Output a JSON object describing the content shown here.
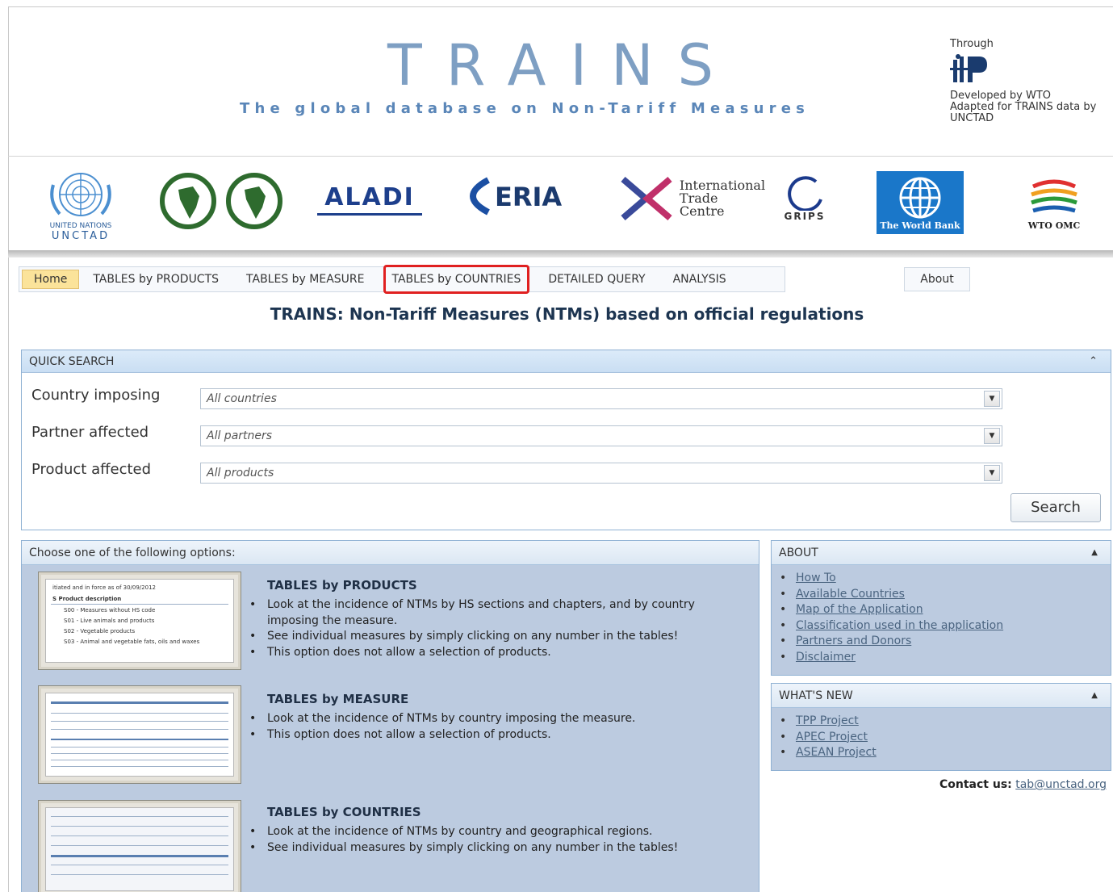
{
  "header": {
    "title": "TRAINS",
    "subtitle": "The global database on Non-Tariff Measures",
    "through_label": "Through",
    "developed_by": "Developed by WTO",
    "adapted_for": "Adapted for TRAINS data by UNCTAD"
  },
  "logos": {
    "unctad_line1": "UNITED NATIONS",
    "unctad_line2": "UNCTAD",
    "aladi": "ALADI",
    "eria": "ERIA",
    "itc_line1": "International",
    "itc_line2": "Trade",
    "itc_line3": "Centre",
    "grips": "GRIPS",
    "worldbank": "The World Bank",
    "wto": "WTO OMC"
  },
  "nav": {
    "home": "Home",
    "tables_products": "TABLES by PRODUCTS",
    "tables_measure": "TABLES by MEASURE",
    "tables_countries": "TABLES by COUNTRIES",
    "detailed_query": "DETAILED QUERY",
    "analysis": "ANALYSIS",
    "about": "About"
  },
  "page_heading": "TRAINS: Non-Tariff Measures (NTMs) based on official regulations",
  "quick_search": {
    "header": "QUICK SEARCH",
    "country_label": "Country imposing",
    "country_value": "All countries",
    "partner_label": "Partner affected",
    "partner_value": "All partners",
    "product_label": "Product affected",
    "product_value": "All products",
    "search_button": "Search"
  },
  "options": {
    "header": "Choose one of the following options:",
    "items": [
      {
        "title": "TABLES by PRODUCTS",
        "bullets": [
          "Look at the incidence of NTMs by HS sections and chapters, and by country imposing the measure.",
          "See individual measures by simply clicking on any number in the tables!",
          "This option does not allow a selection of products."
        ],
        "thumb_lines": [
          "itiated and in force  as of  30/09/2012",
          "S Product description",
          "S00 - Measures without HS code",
          "S01 - Live animals and products",
          "S02 - Vegetable products",
          "S03 - Animal and vegetable fats, oils and waxes"
        ]
      },
      {
        "title": "TABLES by MEASURE",
        "bullets": [
          "Look at the incidence of NTMs by country imposing the measure.",
          "This option does not allow a selection of products."
        ]
      },
      {
        "title": "TABLES by COUNTRIES",
        "bullets": [
          "Look at the incidence of NTMs by country and geographical regions.",
          "See individual measures by simply clicking on any number in the tables!"
        ]
      }
    ]
  },
  "about": {
    "header": "ABOUT",
    "links": [
      "How To",
      "Available Countries",
      "Map of the Application",
      "Classification used in the application",
      "Partners and Donors",
      "Disclaimer"
    ]
  },
  "whats_new": {
    "header": "WHAT'S NEW",
    "links": [
      "TPP Project",
      "APEC Project",
      "ASEAN Project"
    ]
  },
  "contact": {
    "label": "Contact us:",
    "email": "tab@unctad.org"
  },
  "colors": {
    "title_blue": "#7e9fc3",
    "panel_blue": "#bccbe0",
    "home_yellow": "#fbe39a",
    "highlight_red": "#e02020"
  }
}
